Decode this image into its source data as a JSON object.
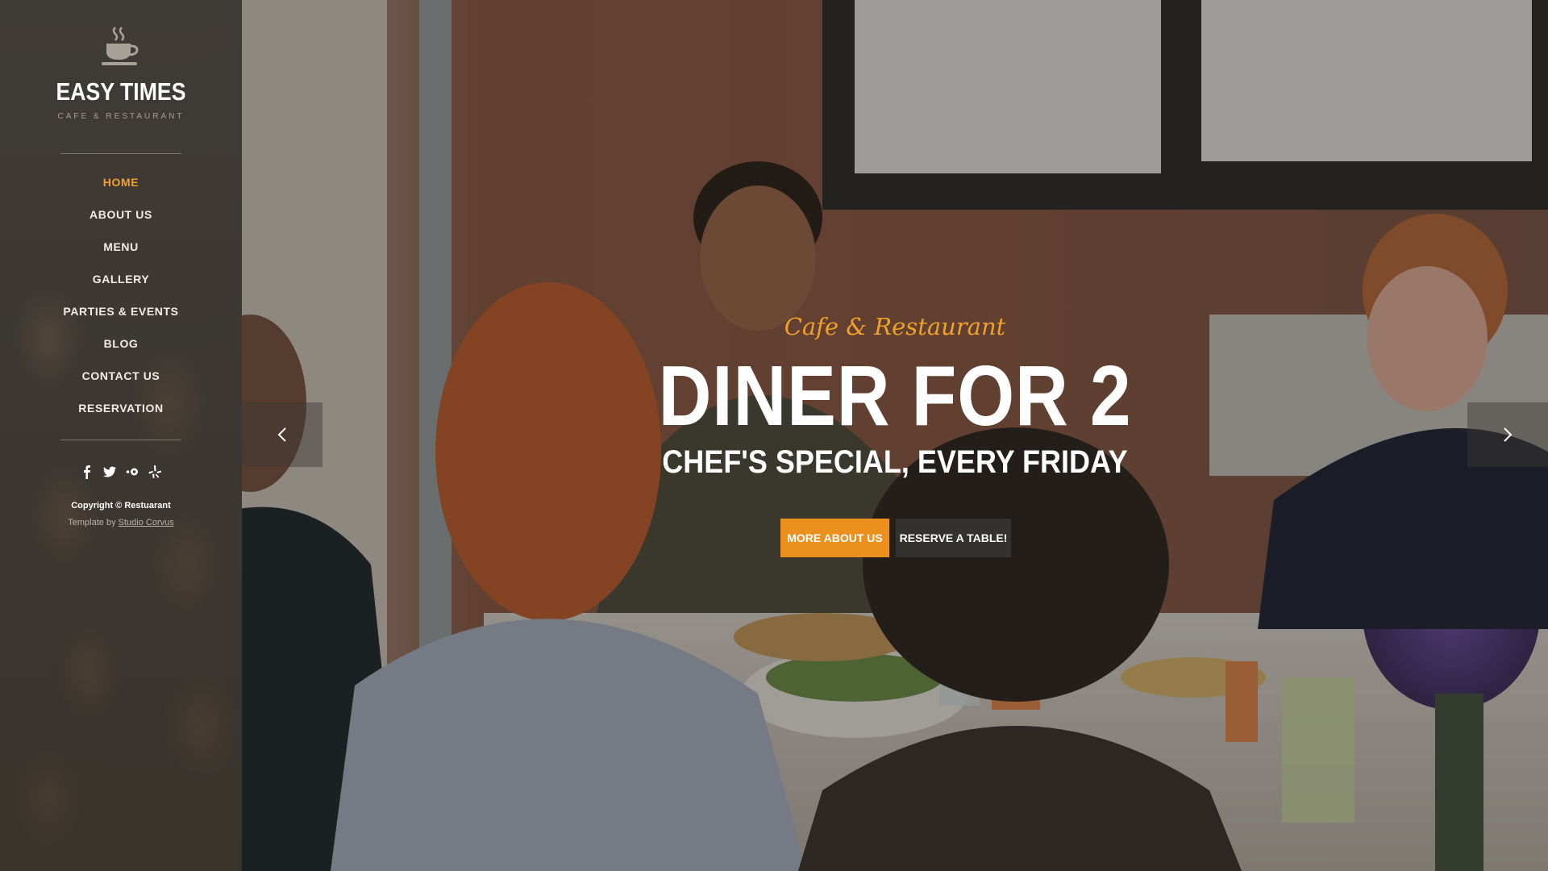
{
  "brand": {
    "name": "EASY TIMES",
    "tagline": "CAFE & RESTAURANT"
  },
  "nav": {
    "items": [
      {
        "label": "HOME",
        "active": true
      },
      {
        "label": "ABOUT US",
        "active": false
      },
      {
        "label": "MENU",
        "active": false
      },
      {
        "label": "GALLERY",
        "active": false
      },
      {
        "label": "PARTIES & EVENTS",
        "active": false
      },
      {
        "label": "BLOG",
        "active": false
      },
      {
        "label": "CONTACT US",
        "active": false
      },
      {
        "label": "RESERVATION",
        "active": false
      }
    ]
  },
  "social": {
    "icons": [
      "facebook-icon",
      "twitter-icon",
      "flickr-icon",
      "yelp-icon"
    ]
  },
  "footer": {
    "copyright": "Copyright © Restuarant",
    "credit_prefix": "Template by ",
    "credit_link": "Studio Corvus"
  },
  "hero": {
    "script_title": "Cafe & Restaurant",
    "headline": "DINER FOR 2",
    "subheadline": "CHEF'S SPECIAL, EVERY FRIDAY",
    "primary_button": "MORE ABOUT US",
    "secondary_button": "RESERVE A TABLE!"
  },
  "colors": {
    "accent": "#f0a129",
    "button_primary": "#eb8f1d",
    "button_secondary": "#333230",
    "sidebar_bg": "#3c3732"
  }
}
